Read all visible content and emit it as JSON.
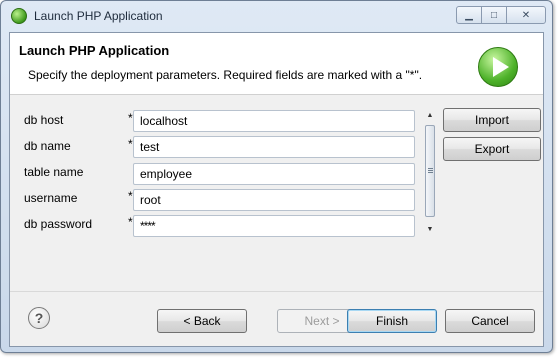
{
  "window": {
    "title": "Launch PHP Application",
    "min_glyph": "▁",
    "max_glyph": "□",
    "close_glyph": "✕"
  },
  "banner": {
    "title": "Launch PHP Application",
    "description": "Specify the deployment parameters. Required fields are marked with a \"*\".",
    "icon": "play-icon"
  },
  "form": {
    "required_marker": "*",
    "fields": [
      {
        "label": "db host",
        "value": "localhost",
        "required": true
      },
      {
        "label": "db name",
        "value": "test",
        "required": true
      },
      {
        "label": "table name",
        "value": "employee",
        "required": false
      },
      {
        "label": "username",
        "value": "root",
        "required": true
      },
      {
        "label": "db password",
        "value": "****",
        "required": true
      }
    ]
  },
  "side_buttons": {
    "import": "Import",
    "export": "Export"
  },
  "footer": {
    "help_glyph": "?",
    "back": "< Back",
    "next": "Next >",
    "finish": "Finish",
    "cancel": "Cancel"
  },
  "background_marks": [
    "l",
    "t",
    "t"
  ],
  "colors": {
    "window_frame": "#c9d8ea",
    "client_bg": "#f0f0f0",
    "default_button_border": "#3c7fb1"
  }
}
